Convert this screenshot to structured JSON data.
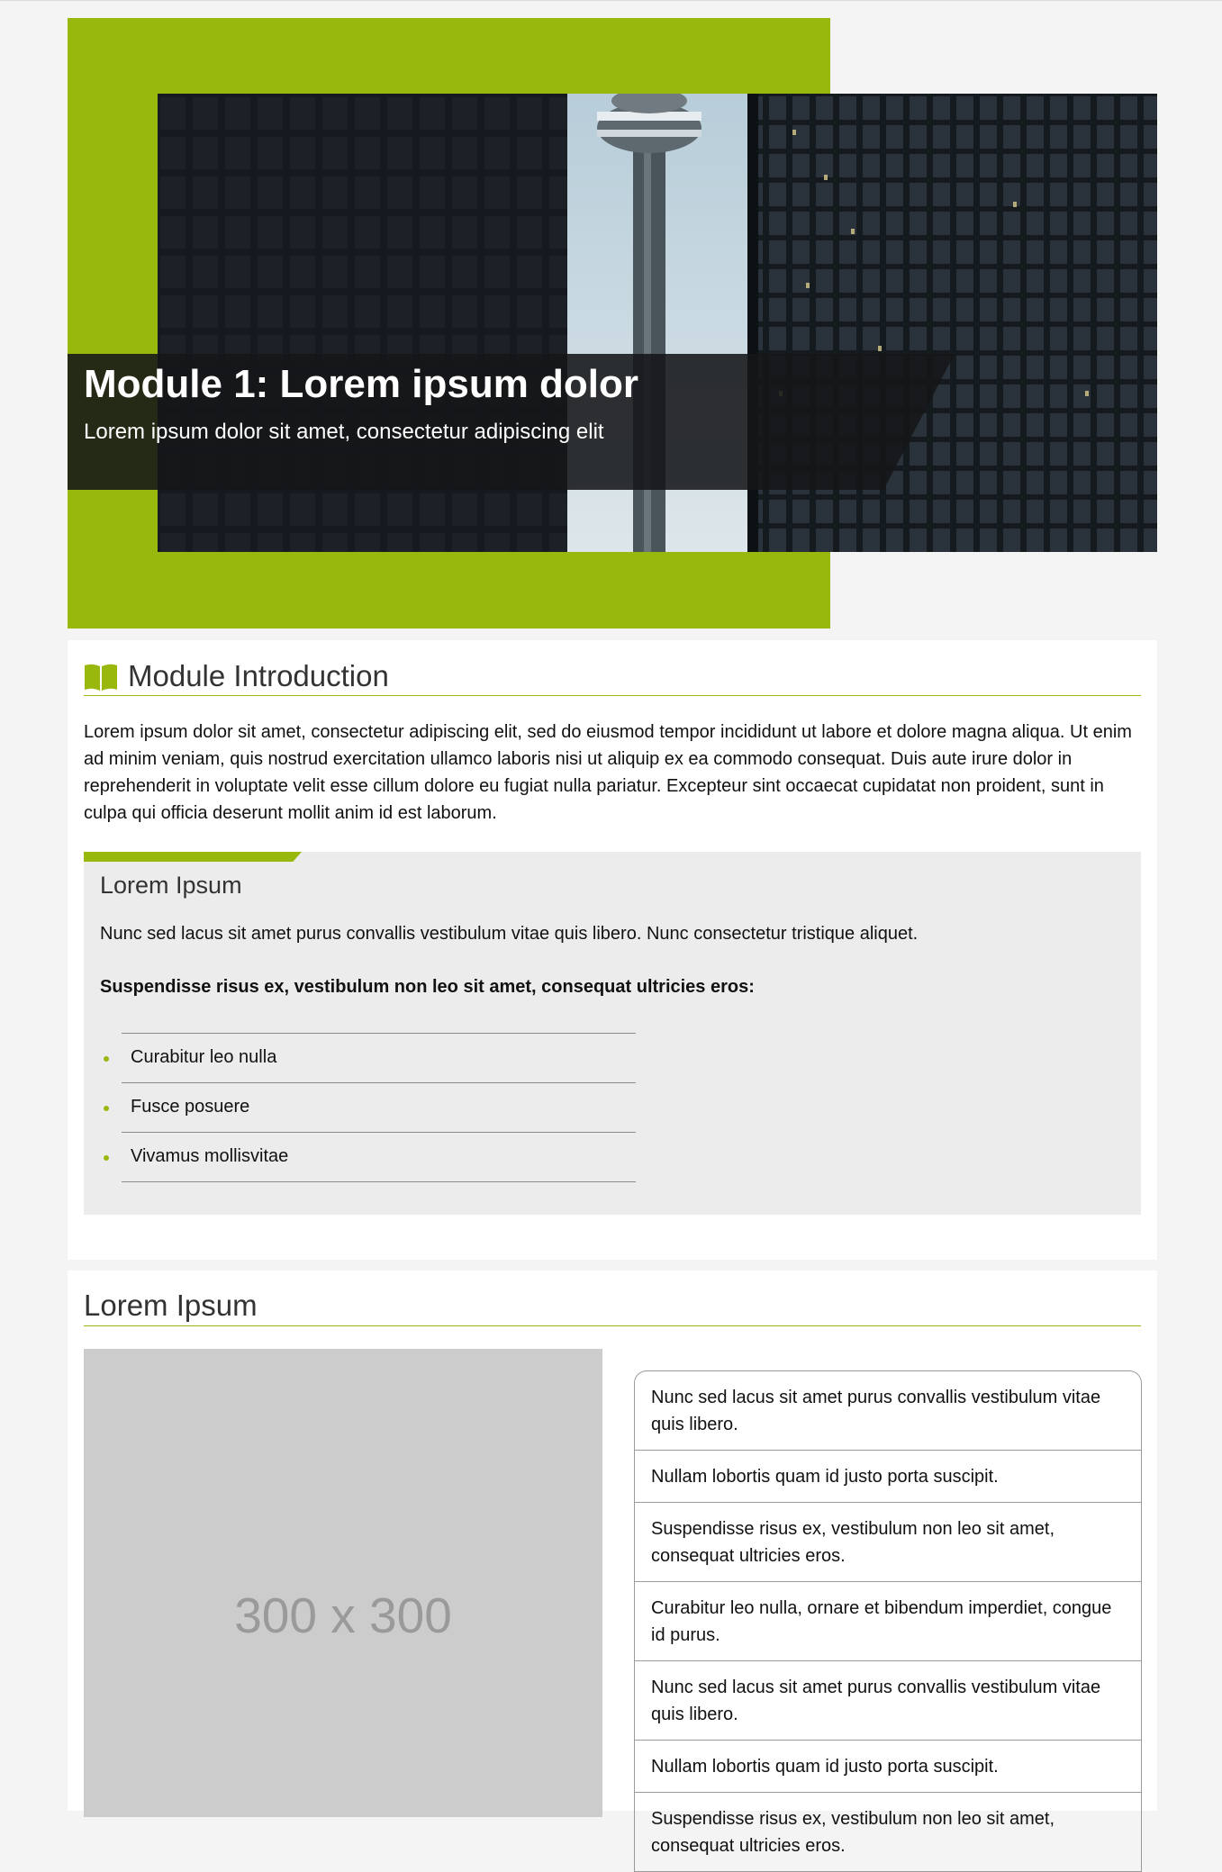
{
  "hero": {
    "title": "Module 1: Lorem ipsum dolor",
    "subtitle": "Lorem ipsum dolor sit amet, consectetur adipiscing elit"
  },
  "intro": {
    "icon": "book-icon",
    "heading": "Module Introduction",
    "paragraph": "Lorem ipsum dolor sit amet, consectetur adipiscing elit, sed do eiusmod tempor incididunt ut labore et dolore magna aliqua. Ut enim ad minim veniam, quis nostrud exercitation ullamco laboris nisi ut aliquip ex ea commodo consequat. Duis aute irure dolor in reprehenderit in voluptate velit esse cillum dolore eu fugiat nulla pariatur. Excepteur sint occaecat cupidatat non proident, sunt in culpa qui officia deserunt mollit anim id est laborum.",
    "box": {
      "heading": "Lorem Ipsum",
      "text": "Nunc sed lacus sit amet purus convallis vestibulum vitae quis libero. Nunc consectetur tristique aliquet.",
      "bold": "Suspendisse risus ex, vestibulum non leo sit amet, consequat ultricies eros:",
      "items": [
        "Curabitur leo nulla",
        "Fusce posuere",
        "Vivamus mollisvitae"
      ]
    }
  },
  "section2": {
    "heading": "Lorem Ipsum",
    "placeholder": "300 x 300",
    "accordion": [
      "Nunc sed lacus sit amet purus convallis vestibulum vitae quis libero.",
      "Nullam lobortis quam id justo porta suscipit.",
      "Suspendisse risus ex, vestibulum non leo sit amet, consequat ultricies eros.",
      "Curabitur leo nulla, ornare et bibendum imperdiet, congue id purus.",
      "Nunc sed lacus sit amet purus convallis vestibulum vitae quis libero.",
      "Nullam lobortis quam id justo porta suscipit.",
      "Suspendisse risus ex, vestibulum non leo sit amet, consequat ultricies eros."
    ]
  },
  "colors": {
    "accent": "#98b80e",
    "page_bg": "#f4f4f4",
    "box_bg": "#ececec"
  }
}
